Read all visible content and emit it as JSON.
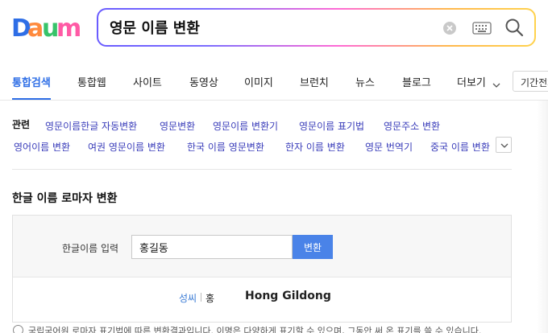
{
  "brand": {
    "name": "Daum",
    "colors": {
      "blue": "#2e6ee6",
      "orange": "#ff8a3d",
      "pink": "#ff5aa5",
      "green": "#38c36a",
      "yellow": "#ffbe2e"
    }
  },
  "search": {
    "query": "영문 이름 변환",
    "clear_icon": "close-circle-icon",
    "keyboard_icon": "keyboard-icon",
    "search_icon": "magnifier-icon"
  },
  "tabs": [
    {
      "label": "통합검색",
      "active": true
    },
    {
      "label": "통합웹"
    },
    {
      "label": "사이트"
    },
    {
      "label": "동영상"
    },
    {
      "label": "이미지"
    },
    {
      "label": "브런치"
    },
    {
      "label": "뉴스"
    },
    {
      "label": "블로그"
    },
    {
      "label": "더보기"
    }
  ],
  "period_filter": {
    "label": "기간전체"
  },
  "related": {
    "label": "관련",
    "items": [
      "영문이름한글 자동변환",
      "영문변환",
      "영문이름 변환기",
      "영문이름 표기법",
      "영문주소 변환",
      "영어이름 변환",
      "여권 영문이름 변환",
      "한국 이름 영문변환",
      "한자 이름 변환",
      "영문 번역기",
      "중국 이름 변환"
    ]
  },
  "converter": {
    "title": "한글 이름 로마자 변환",
    "input_label": "한글이름 입력",
    "input_value": "홍길동",
    "button_label": "변환",
    "result": {
      "label": "성씨",
      "char": "홍",
      "roman": "Hong Gildong"
    }
  },
  "notice": "국립국어원 로마자 표기법에 따른 변환결과입니다. 이명은 다양하게 표기할 수 있으며, 그동안 써 온 표기를 쓸 수 있습니다."
}
